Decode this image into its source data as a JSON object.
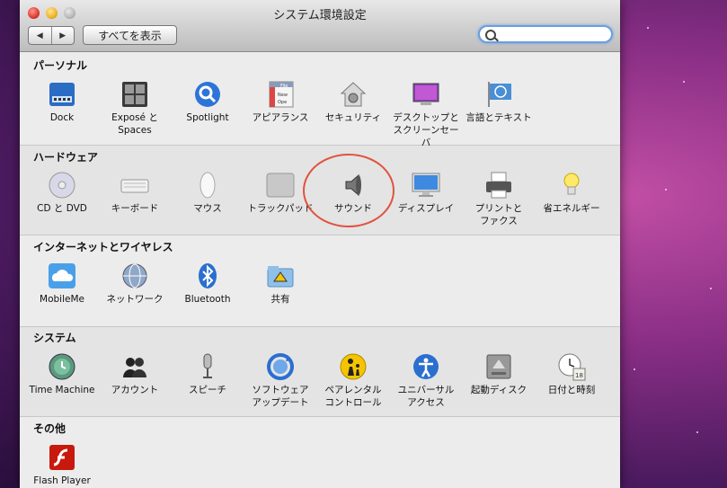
{
  "window": {
    "title": "システム環境設定"
  },
  "toolbar": {
    "back": "◀",
    "forward": "▶",
    "show_all": "すべてを表示",
    "search_placeholder": ""
  },
  "sections": {
    "personal": {
      "title": "パーソナル",
      "items": [
        "Dock",
        "Exposé と\nSpaces",
        "Spotlight",
        "アピアランス",
        "セキュリティ",
        "デスクトップと\nスクリーンセーバ",
        "言語とテキスト"
      ]
    },
    "hardware": {
      "title": "ハードウェア",
      "items": [
        "CD と DVD",
        "キーボード",
        "マウス",
        "トラックパッド",
        "サウンド",
        "ディスプレイ",
        "プリントと\nファクス",
        "省エネルギー"
      ]
    },
    "internet": {
      "title": "インターネットとワイヤレス",
      "items": [
        "MobileMe",
        "ネットワーク",
        "Bluetooth",
        "共有"
      ]
    },
    "system": {
      "title": "システム",
      "items": [
        "Time Machine",
        "アカウント",
        "スピーチ",
        "ソフトウェア\nアップデート",
        "ペアレンタル\nコントロール",
        "ユニバーサル\nアクセス",
        "起動ディスク",
        "日付と時刻"
      ]
    },
    "other": {
      "title": "その他",
      "items": [
        "Flash Player"
      ]
    }
  },
  "icons": {
    "file_icon_text": "File",
    "file_icon_new": "New",
    "file_icon_open": "Ope",
    "calendar_day": "18"
  },
  "colors": {
    "highlight": "#e0533f",
    "search_focus": "#6a9fe0"
  }
}
